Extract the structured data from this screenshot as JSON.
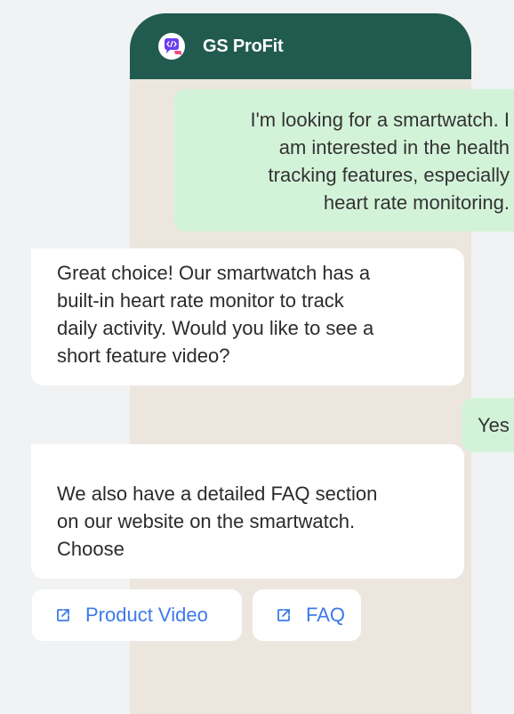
{
  "app": {
    "title": "GS ProFit",
    "logo_icon": "chat-code-logo-icon"
  },
  "colors": {
    "header_bg": "#215b4f",
    "chat_bg": "#ece6df",
    "outgoing_bubble": "#d3f3d9",
    "incoming_bubble": "#ffffff",
    "link_blue": "#3d7ae8"
  },
  "messages": [
    {
      "direction": "outgoing",
      "lines": [
        "I'm looking for a smartwatch. I",
        "am interested in the health",
        "tracking features, especially",
        "heart rate monitoring."
      ]
    },
    {
      "direction": "incoming",
      "lines": [
        "Great choice! Our smartwatch has a",
        "built-in heart rate monitor to track",
        "daily activity. Would you like to see a",
        "short feature video?"
      ]
    },
    {
      "direction": "outgoing",
      "lines": [
        "Yes"
      ]
    },
    {
      "direction": "incoming",
      "lines": [
        "We also have a detailed FAQ section",
        "on our website on the smartwatch.",
        "Choose"
      ]
    }
  ],
  "quick_replies": [
    {
      "label": "Product Video",
      "icon": "external-link-icon"
    },
    {
      "label": "FAQ",
      "icon": "external-link-icon"
    }
  ]
}
